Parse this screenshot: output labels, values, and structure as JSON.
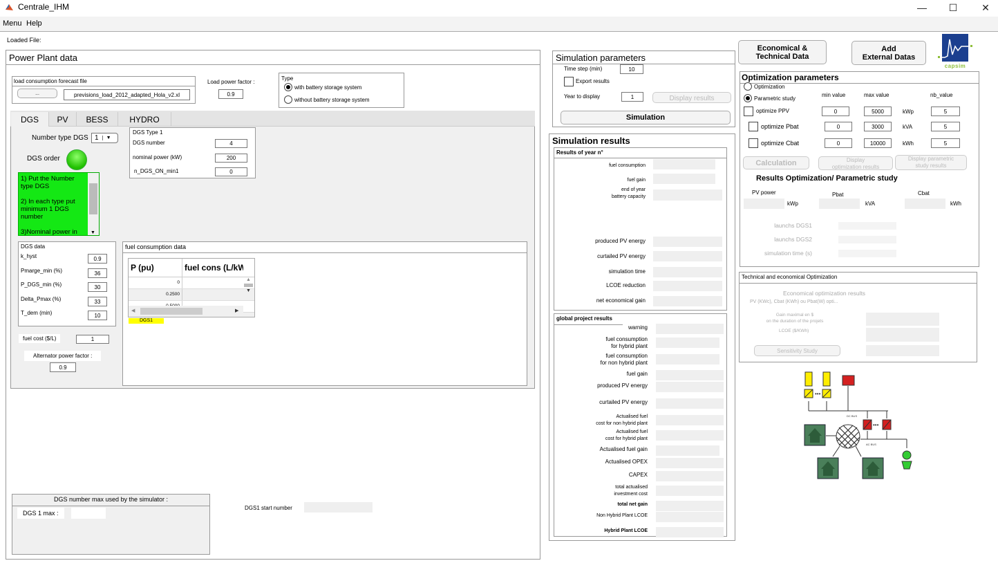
{
  "window": {
    "title": "Centrale_IHM",
    "minimize": "—",
    "maximize": "☐",
    "close": "✕"
  },
  "menu": [
    "Menu",
    "Help"
  ],
  "loaded_file_label": "Loaded File:",
  "power_plant": {
    "title": "Power Plant data",
    "load_file": {
      "title": "load consumption forecast file",
      "browse_label": "...",
      "file_name": "previsions_load_2012_adapted_Hola_v2.xl"
    },
    "load_pf": {
      "label": "Load power factor :",
      "value": "0.9"
    },
    "type": {
      "title": "Type",
      "options": [
        "with battery storage system",
        "without battery storage system"
      ],
      "selected": 0
    },
    "tabs": [
      "DGS",
      "PV",
      "BESS",
      "HYDRO"
    ],
    "active_tab": "DGS",
    "dgs": {
      "number_type_label": "Number type DGS",
      "number_type_value": "1",
      "order_label": "DGS order",
      "instructions": "1) Put the Number type DGS\n\n2) In each type put minimum 1 DGS number\n\n3)Nominal power in",
      "type_panel": {
        "title": "DGS Type 1",
        "rows": [
          {
            "label": "DGS number",
            "value": "4"
          },
          {
            "label": "nominal power (kW)",
            "value": "200"
          },
          {
            "label": "n_DGS_ON_min1",
            "value": "0"
          }
        ]
      },
      "data_panel": {
        "title": "DGS data",
        "rows": [
          {
            "label": "k_hyst",
            "value": "0.9"
          },
          {
            "label": "Pmarge_min (%)",
            "value": "36"
          },
          {
            "label": "P_DGS_min (%)",
            "value": "30"
          },
          {
            "label": "Delta_Pmax (%)",
            "value": "33"
          },
          {
            "label": "T_dem (min)",
            "value": "10"
          }
        ]
      },
      "fuel_cost": {
        "label": "fuel  cost ($/L)",
        "value": "1"
      },
      "alternator_pf": {
        "label": "Alternator power factor :",
        "value": "0.9"
      },
      "fuel_table": {
        "title": "fuel consumption data",
        "columns": [
          "P (pu)",
          "fuel cons (L/kW"
        ],
        "rows": [
          [
            "0",
            ""
          ],
          [
            "0.2500",
            ""
          ],
          [
            "0.5000",
            ""
          ]
        ],
        "tag": "DGS1"
      },
      "max_panel": {
        "title": "DGS number max used by the simulator :",
        "label": "DGS 1 max :",
        "value": ""
      },
      "start_number_label": "DGS1 start number"
    }
  },
  "sim_params": {
    "title": "Simulation parameters",
    "time_step": {
      "label": "Time step (min)",
      "value": "10"
    },
    "export_label": "Export results",
    "year": {
      "label": "Year to display",
      "value": "1"
    },
    "display_btn": "Display results",
    "simulation_btn": "Simulation"
  },
  "sim_results": {
    "title": "Simulation results",
    "year_panel": {
      "title": "Results of year n°",
      "rows": [
        "fuel consumption",
        "fuel gain",
        "end of year\nbattery capacity",
        "produced PV energy",
        "curtailed PV energy",
        "simulation time",
        "LCOE reduction",
        "net economical gain"
      ]
    },
    "global_panel": {
      "title": "global project results",
      "rows": [
        "warning",
        "fuel consumption\nfor hybrid plant",
        "fuel consumption\nfor non hybrid plant",
        "fuel gain",
        "produced PV energy",
        "curtailed PV energy",
        "Actualised fuel\ncost for non hybrid plant",
        "Actualised fuel\ncost for hybrid plant",
        "Actualised fuel gain",
        "Actualised OPEX",
        "CAPEX",
        "total actualised\ninvestment cost",
        "total net gain",
        "Non Hybrid Plant LCOE",
        "Hybrid Plant LCOE"
      ]
    }
  },
  "top_buttons": {
    "eco_tech": "Economical &\nTechnical Data",
    "add_ext": "Add\nExternal Datas",
    "logo_text": "capsim"
  },
  "optim": {
    "title": "Optimization parameters",
    "modes": [
      "Optimization",
      "Parametric study"
    ],
    "selected_mode": 1,
    "col_headers": [
      "min value",
      "max value",
      "nb_value"
    ],
    "rows": [
      {
        "label": "optimize PPV",
        "min": "0",
        "max": "5000",
        "unit": "kWp",
        "nb": "5"
      },
      {
        "label": "optimize Pbat",
        "min": "0",
        "max": "3000",
        "unit": "kVA",
        "nb": "5"
      },
      {
        "label": "optimize Cbat",
        "min": "0",
        "max": "10000",
        "unit": "kWh",
        "nb": "5"
      }
    ],
    "calc_btn": "Calculation",
    "disp_opt_btn": "Display\noptimization results",
    "disp_param_btn": "Display parametric\nstudy results",
    "results_title": "Results Optimization/ Parametric study",
    "result_labels": [
      "PV power",
      "Pbat",
      "Cbat"
    ],
    "result_units": [
      "kWp",
      "kVA",
      "kWh"
    ],
    "launch_labels": [
      "launchs DGS1",
      "launchs DGS2",
      "simulation time (s)"
    ]
  },
  "tech_eco": {
    "title": "Technical and economical Optimization",
    "subtitle": "Economical optimization results",
    "hint": "PV (KWc), Cbat (KWh) ou Pbat(W) opti...",
    "gain_label": "Gain maximal en $\non the duration of the projets",
    "lcoe_label": "LCOE ($/KWh)",
    "sensitivity_btn": "Sensitivity Study"
  },
  "diagram": {
    "dc_bus": "DC BUS",
    "ac_bus": "AC BUS"
  }
}
